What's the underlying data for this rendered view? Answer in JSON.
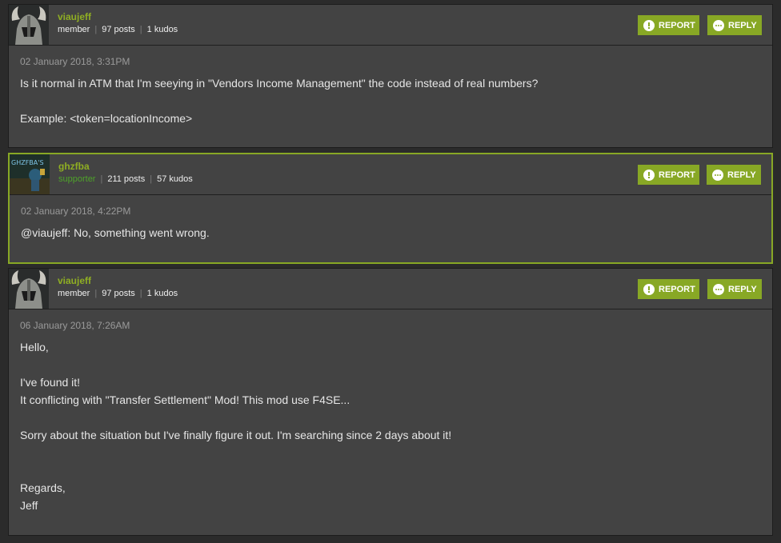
{
  "buttons": {
    "report": "REPORT",
    "reply": "REPLY"
  },
  "posts": [
    {
      "username": "viaujeff",
      "role": "member",
      "posts": "97 posts",
      "kudos": "1 kudos",
      "timestamp": "02 January 2018, 3:31PM",
      "lines": [
        "Is it normal in ATM that I'm seeying in \"Vendors Income Management\" the code instead of real numbers?",
        "",
        "Example: <token=locationIncome>"
      ]
    },
    {
      "username": "ghzfba",
      "role": "supporter",
      "posts": "211 posts",
      "kudos": "57 kudos",
      "avatar_text": "GHZFBA'S",
      "timestamp": "02 January 2018, 4:22PM",
      "lines": [
        "@viaujeff: No, something went wrong."
      ]
    },
    {
      "username": "viaujeff",
      "role": "member",
      "posts": "97 posts",
      "kudos": "1 kudos",
      "timestamp": "06 January 2018, 7:26AM",
      "lines": [
        "Hello,",
        "",
        "I've found it!",
        "It conflicting with \"Transfer Settlement\" Mod! This mod use F4SE...",
        "",
        "Sorry about the situation but I've finally figure it out. I'm searching since 2 days about it!",
        "",
        "",
        "Regards,",
        "Jeff"
      ]
    }
  ]
}
